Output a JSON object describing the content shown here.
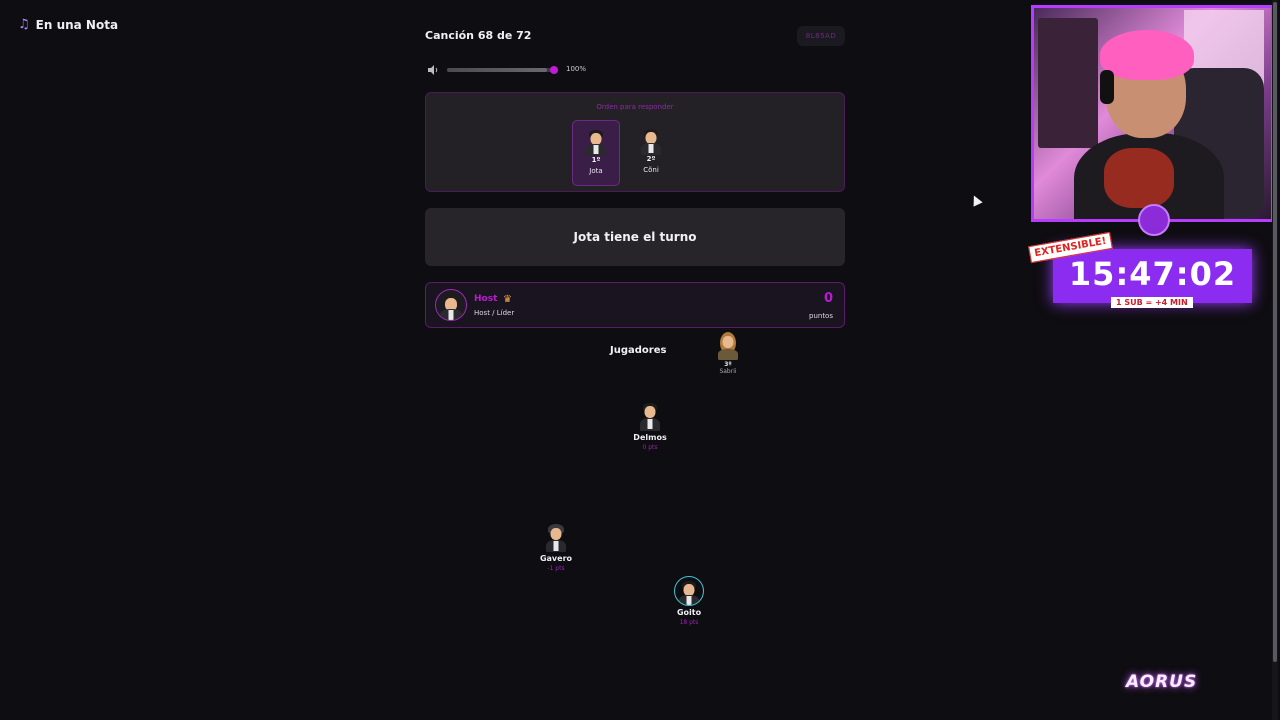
{
  "app": {
    "title": "En una Nota",
    "icon": "music-note-icon"
  },
  "header": {
    "song_counter": "Canción 68 de 72",
    "room_code": "8L85AD"
  },
  "volume": {
    "level": 0.93,
    "label": "100%",
    "icon": "speaker-icon"
  },
  "answer_order": {
    "title": "Orden para responder",
    "slots": [
      {
        "position": "1º",
        "name": "Jota",
        "active": true
      },
      {
        "position": "2º",
        "name": "Cõni",
        "active": false
      }
    ]
  },
  "turn": {
    "message": "Jota tiene el turno"
  },
  "host": {
    "name": "Host",
    "role": "Host / Líder",
    "points": "0",
    "points_label": "puntos",
    "icon": "crown-icon"
  },
  "players_section": {
    "title": "Jugadores",
    "players": [
      {
        "name": "Delmos",
        "points": "0 pts"
      },
      {
        "name": "Gavero",
        "points": "-1 pts"
      },
      {
        "name": "Goito",
        "points": "18 pts"
      },
      {
        "rank": "3º",
        "sub": "Sabrii"
      }
    ]
  },
  "stream_overlay": {
    "timer": "15:47:02",
    "extensible": "EXTENSIBLE!",
    "sub_rule": "1 SUB = +4 MIN",
    "brand_logo": "AORUS"
  },
  "colors": {
    "accent": "#b81bd0",
    "background": "#0e0d11",
    "card": "#272529",
    "timer_bg": "#8b2cf0"
  }
}
